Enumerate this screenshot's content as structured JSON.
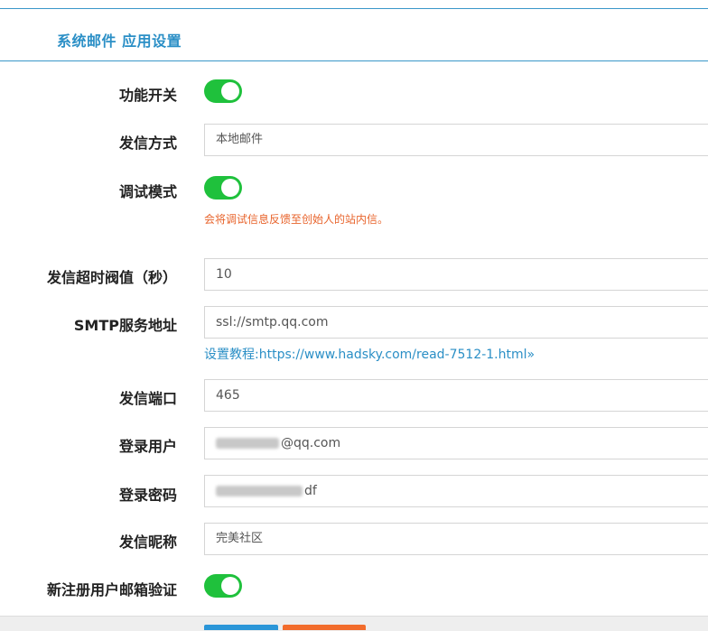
{
  "header": {
    "title": "系统邮件 应用设置"
  },
  "form": {
    "feature_switch": {
      "label": "功能开关",
      "enabled": true
    },
    "send_method": {
      "label": "发信方式",
      "value": "本地邮件"
    },
    "debug_mode": {
      "label": "调试模式",
      "enabled": true,
      "hint": "会将调试信息反馈至创始人的站内信。"
    },
    "timeout": {
      "label": "发信超时阀值（秒）",
      "value": "10"
    },
    "smtp_server": {
      "label": "SMTP服务地址",
      "value": "ssl://smtp.qq.com",
      "help_link": "设置教程:https://www.hadsky.com/read-7512-1.html»"
    },
    "port": {
      "label": "发信端口",
      "value": "465"
    },
    "login_user": {
      "label": "登录用户",
      "value_suffix": "@qq.com"
    },
    "login_password": {
      "label": "登录密码",
      "value_suffix": "df"
    },
    "sender_name": {
      "label": "发信昵称",
      "value": "完美社区"
    },
    "register_verify": {
      "label": "新注册用户邮箱验证",
      "enabled": true
    }
  },
  "colors": {
    "accent": "#2b8fc6",
    "toggle_on": "#1fc13c",
    "warning": "#e8642c",
    "save_button": "#2b96d8",
    "reset_button": "#f26c2c"
  }
}
